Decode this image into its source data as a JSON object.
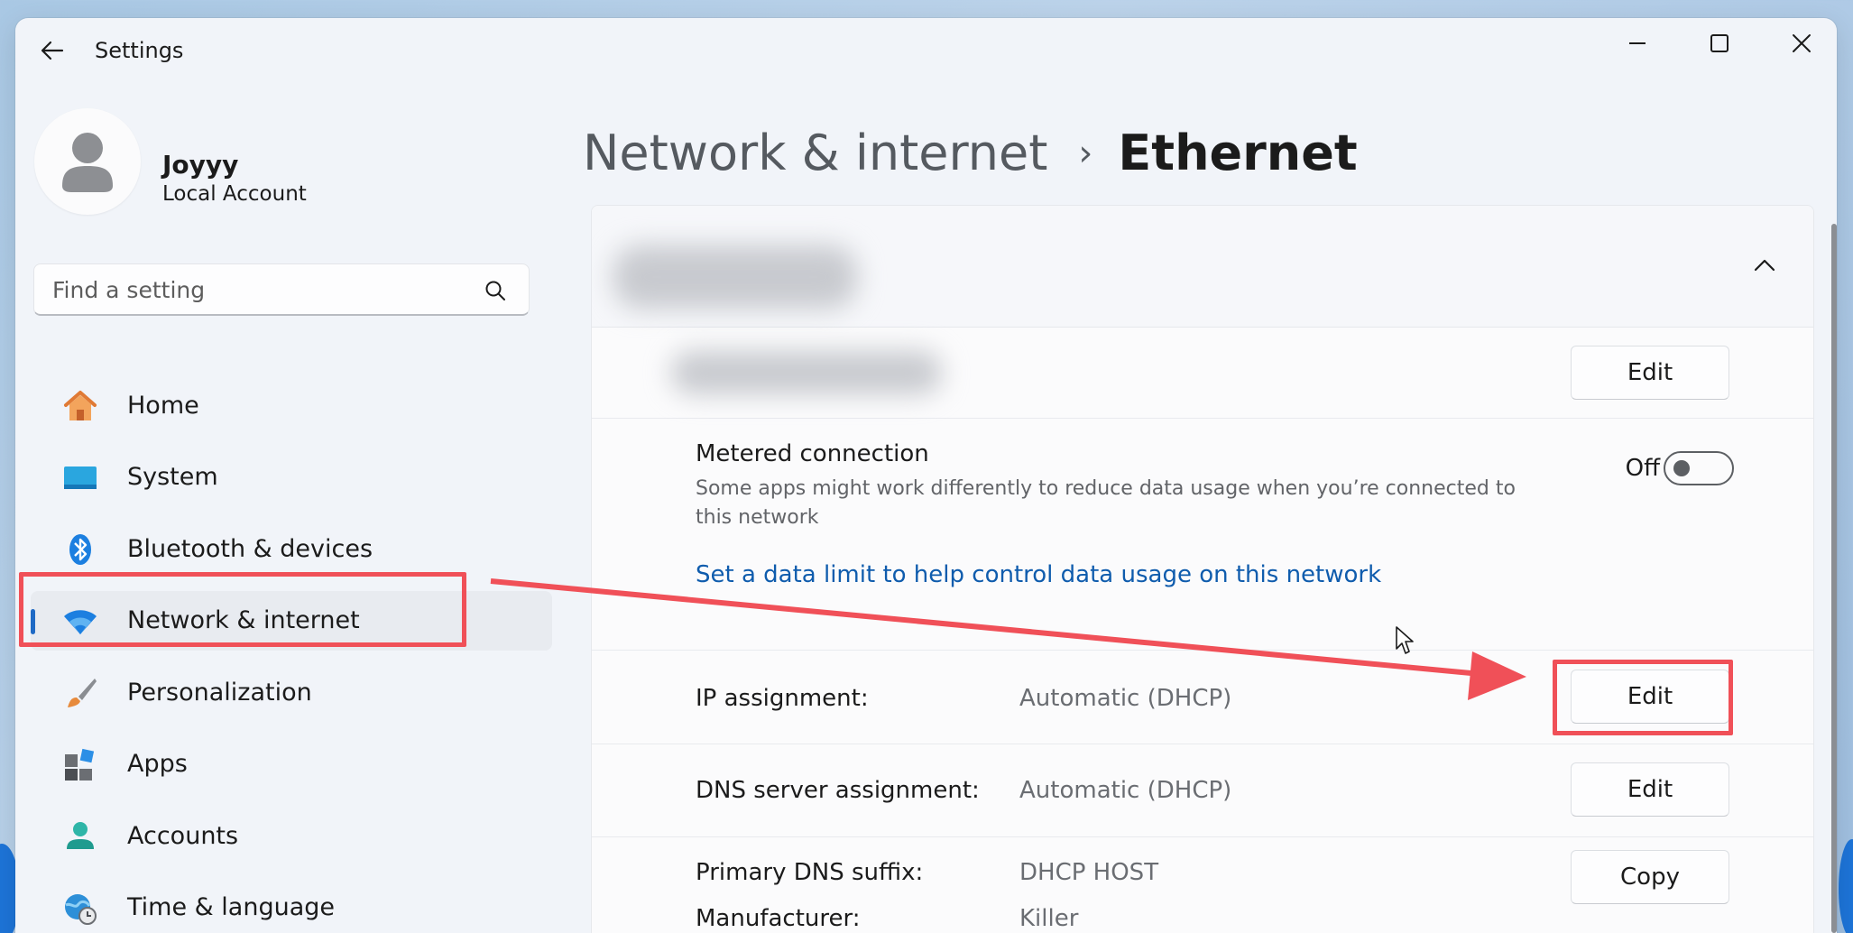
{
  "window": {
    "title": "Settings"
  },
  "profile": {
    "name": "Joyyy",
    "account_type": "Local Account"
  },
  "search": {
    "placeholder": "Find a setting"
  },
  "sidebar": {
    "items": [
      {
        "label": "Home",
        "icon": "home-icon"
      },
      {
        "label": "System",
        "icon": "system-icon"
      },
      {
        "label": "Bluetooth & devices",
        "icon": "bluetooth-icon"
      },
      {
        "label": "Network & internet",
        "icon": "wifi-icon",
        "selected": true
      },
      {
        "label": "Personalization",
        "icon": "paintbrush-icon"
      },
      {
        "label": "Apps",
        "icon": "apps-icon"
      },
      {
        "label": "Accounts",
        "icon": "accounts-icon"
      },
      {
        "label": "Time & language",
        "icon": "globe-clock-icon"
      }
    ]
  },
  "header": {
    "parent": "Network & internet",
    "separator": "›",
    "current": "Ethernet"
  },
  "content": {
    "top_edit_label": "Edit",
    "metered": {
      "title": "Metered connection",
      "description": "Some apps might work differently to reduce data usage when you’re connected to this network",
      "toggle_state": "Off"
    },
    "data_limit_link": "Set a data limit to help control data usage on this network",
    "ip_assignment": {
      "label": "IP assignment:",
      "value": "Automatic (DHCP)",
      "button": "Edit"
    },
    "dns_assignment": {
      "label": "DNS server assignment:",
      "value": "Automatic (DHCP)",
      "button": "Edit"
    },
    "primary_dns_suffix": {
      "label": "Primary DNS suffix:",
      "value": "DHCP HOST",
      "button": "Copy"
    },
    "manufacturer": {
      "label": "Manufacturer:",
      "value": "Killer"
    }
  },
  "colors": {
    "accent": "#1f6ac5",
    "link": "#0f5cad",
    "annotation": "#f05058"
  }
}
